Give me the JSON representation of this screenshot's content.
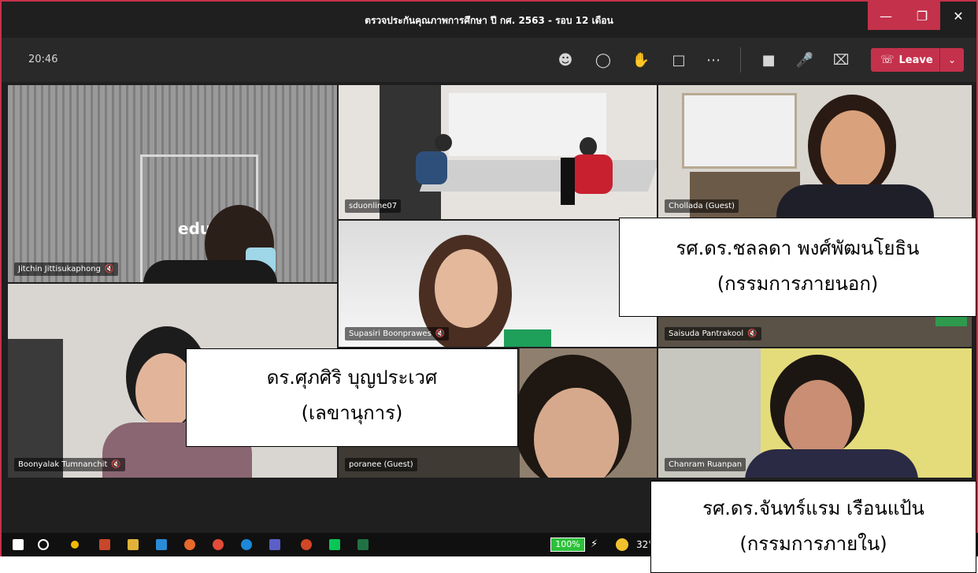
{
  "window": {
    "title": "ตรวจประกันคุณภาพการศึกษา ปี กศ. 2563 - รอบ 12 เดือน"
  },
  "toolbar": {
    "time": "20:46",
    "leave_label": "Leave",
    "icons": [
      "participants-icon",
      "chat-icon",
      "raise-hand-icon",
      "share-tray-icon",
      "more-actions-icon",
      "camera-off-icon",
      "mic-off-icon",
      "share-screen-icon"
    ]
  },
  "participants": [
    {
      "name": "Jitchin Jittisukaphong",
      "muted": true
    },
    {
      "name": "sduonline07",
      "muted": false
    },
    {
      "name": "Chollada (Guest)",
      "muted": false
    },
    {
      "name": "Supasiri Boonprawes",
      "muted": true
    },
    {
      "name": "Saisuda Pantrakool",
      "muted": true
    },
    {
      "name": "Boonyalak Tumnanchit",
      "muted": true
    },
    {
      "name": "poranee (Guest)",
      "muted": false
    },
    {
      "name": "Chanram Ruanpan",
      "muted": false
    }
  ],
  "wall_text": "educat",
  "captions": {
    "external": {
      "line1": "รศ.ดร.ชลลดา พงศ์พัฒนโยธิน",
      "line2": "(กรรมการภายนอก)"
    },
    "secretary": {
      "line1": "ดร.ศุภศิริ บุญประเวศ",
      "line2": "(เลขานุการ)"
    },
    "internal": {
      "line1": "รศ.ดร.จันทร์แรม เรือนแป้น",
      "line2": "(กรรมการภายใน)"
    }
  },
  "taskbar": {
    "battery": "100%",
    "temperature": "32°"
  },
  "colors": {
    "leave": "#c4314b",
    "frame": "#c4314b",
    "background": "#1f1f1f"
  }
}
